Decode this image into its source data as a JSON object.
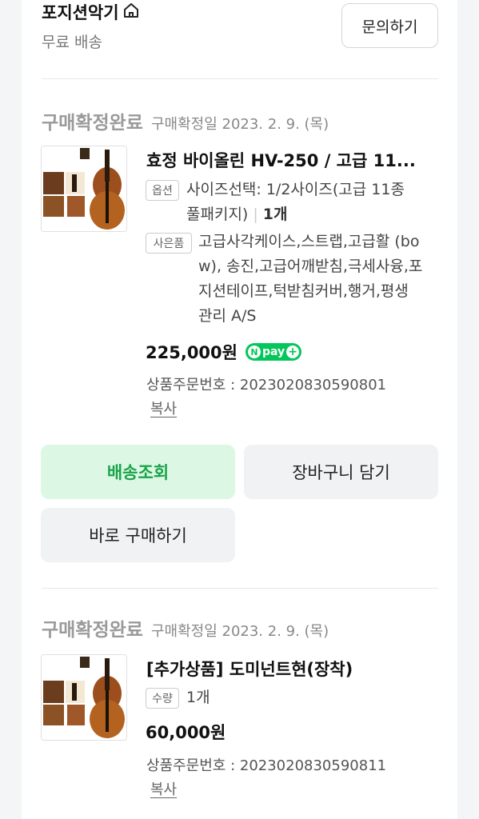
{
  "store": {
    "name": "포지션악기",
    "shipping": "무료 배송",
    "inquiry_label": "문의하기"
  },
  "orders": [
    {
      "status": "구매확정완료",
      "confirm_date": "구매확정일 2023. 2. 9. (목)",
      "title": "효정 바이올린 HV-250 / 고급 11...",
      "option_badge": "옵션",
      "option_line1": "사이즈선택: 1/2사이즈(고급 11종",
      "option_line2": "풀패키지)",
      "option_qty": "1개",
      "gift_badge": "사은품",
      "gift_lines": [
        "고급사각케이스,스트랩,고급활 (bo",
        "w), 송진,고급어깨받침,극세사융,포",
        "지션테이프,턱받침커버,행거,평생",
        "관리 A/S"
      ],
      "price": "225,000원",
      "npay": "pay",
      "order_no": "상품주문번호 : 2023020830590801",
      "copy_label": "복사"
    },
    {
      "status": "구매확정완료",
      "confirm_date": "구매확정일 2023. 2. 9. (목)",
      "title": "[추가상품] 도미넌트현(장착)",
      "qty_badge": "수량",
      "qty": "1개",
      "price": "60,000원",
      "order_no": "상품주문번호 : 2023020830590811",
      "copy_label": "복사"
    }
  ],
  "actions": {
    "track_delivery": "배송조회",
    "add_cart": "장바구니 담기",
    "buy_now": "바로 구매하기"
  },
  "colors": {
    "green": "#1aa34a",
    "green_bg": "#dcf8e4",
    "npay_green": "#03c75a"
  }
}
